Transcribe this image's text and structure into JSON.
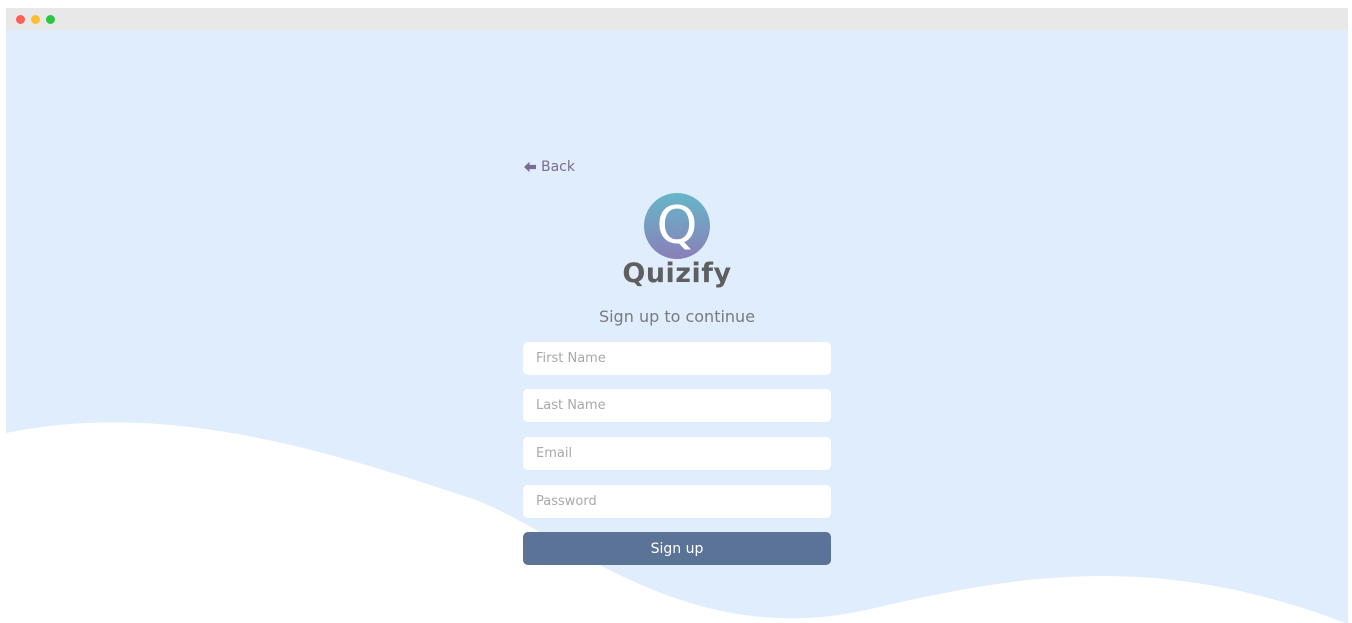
{
  "window": {
    "traffic_lights": [
      "#fe5f57",
      "#febc2e",
      "#28c840"
    ]
  },
  "colors": {
    "background": "#e0edfd",
    "accent": "#5b7397",
    "link": "#7d6b96",
    "logo_gradient": [
      "#65b7c9",
      "#8a7fb8"
    ]
  },
  "nav": {
    "back_label": "Back",
    "back_icon": "arrow-left-icon"
  },
  "brand": {
    "logo_letter": "Q",
    "name": "Quizify"
  },
  "form": {
    "heading": "Sign up to continue",
    "fields": [
      {
        "name": "first-name",
        "placeholder": "First Name",
        "value": ""
      },
      {
        "name": "last-name",
        "placeholder": "Last Name",
        "value": ""
      },
      {
        "name": "email",
        "placeholder": "Email",
        "value": ""
      },
      {
        "name": "password",
        "placeholder": "Password",
        "value": ""
      }
    ],
    "submit_label": "Sign up"
  }
}
